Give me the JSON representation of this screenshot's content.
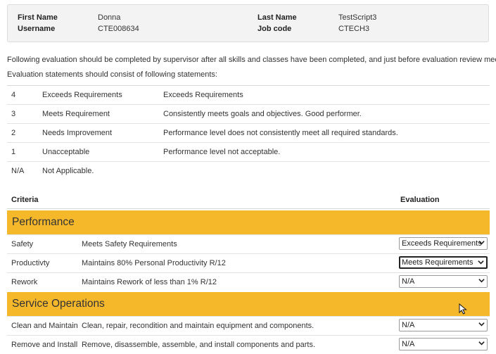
{
  "employee": {
    "first_name_label": "First Name",
    "first_name": "Donna",
    "username_label": "Username",
    "username": "CTE008634",
    "last_name_label": "Last Name",
    "last_name": "TestScript3",
    "job_code_label": "Job code",
    "job_code": "CTECH3"
  },
  "intro": {
    "line1": "Following evaluation should be completed by supervisor after all skills and classes have been completed, and just before evaluation review meeting.",
    "line2": "Evaluation statements should consist of following statements:"
  },
  "scale": [
    {
      "code": "4",
      "label": "Exceeds Requirements",
      "description": "Exceeds Requirements"
    },
    {
      "code": "3",
      "label": "Meets Requirement",
      "description": "Consistently meets goals and objectives. Good performer."
    },
    {
      "code": "2",
      "label": "Needs Improvement",
      "description": "Performance level does not consistently meet all required standards."
    },
    {
      "code": "1",
      "label": "Unacceptable",
      "description": "Performance level not acceptable."
    },
    {
      "code": "N/A",
      "label": "Not Applicable.",
      "description": ""
    }
  ],
  "table_header": {
    "criteria": "Criteria",
    "evaluation": "Evaluation"
  },
  "sections": [
    {
      "title": "Performance",
      "rows": [
        {
          "name": "Safety",
          "description": "Meets Safety Requirements",
          "evaluation": "Exceeds Requirements"
        },
        {
          "name": "Productivty",
          "description": "Maintains 80% Personal Productivity R/12",
          "evaluation": "Meets Requirements"
        },
        {
          "name": "Rework",
          "description": "Maintains Rework of less than 1% R/12",
          "evaluation": "N/A"
        }
      ]
    },
    {
      "title": "Service Operations",
      "rows": [
        {
          "name": "Clean and Maintain",
          "description": "Clean, repair, recondition and maintain equipment and components.",
          "evaluation": "N/A"
        },
        {
          "name": "Remove and Install",
          "description": "Remove, disassemble, assemble, and install components and parts.",
          "evaluation": "N/A"
        }
      ]
    }
  ],
  "icons": {
    "dropdown": "chevron-down-icon",
    "cursor": "mouse-pointer-icon"
  }
}
